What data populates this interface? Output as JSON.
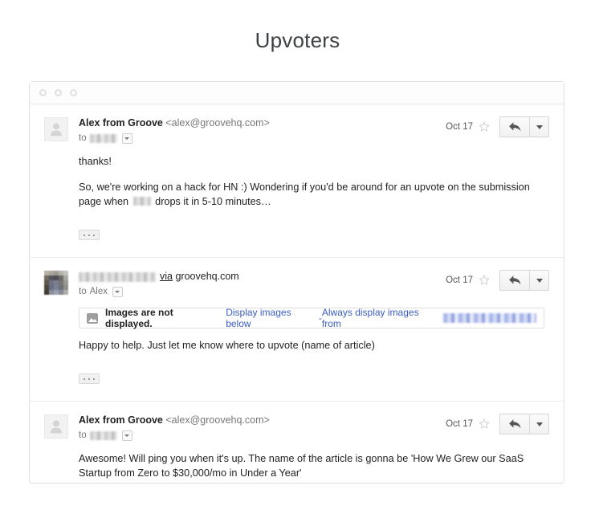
{
  "page": {
    "title": "Upvoters"
  },
  "window": {
    "traffic_lights": [
      "close-dot",
      "minimize-dot",
      "maximize-dot"
    ]
  },
  "thread": {
    "messages": [
      {
        "id": "message-1",
        "avatar_type": "default-person",
        "sender_name": "Alex from Groove",
        "sender_email": "<alex@groovehq.com>",
        "to_label": "to",
        "to_recipient_redacted": true,
        "date": "Oct 17",
        "star_state": "unstarred",
        "reply_label": "reply-arrow",
        "more_label": "more-options",
        "paragraphs": [
          "thanks!",
          "So, we're working on a hack for HN :) Wondering if you'd be around for an upvote on the submission page when ",
          " drops it in 5-10 minutes…"
        ],
        "has_redaction_inline": true,
        "has_trim_button": true,
        "has_image_bar": false
      },
      {
        "id": "message-2",
        "avatar_type": "blurred-photo",
        "sender_name_redacted": true,
        "via_word": "via",
        "via_domain": "groovehq.com",
        "to_label": "to",
        "to_recipient": "Alex",
        "date": "Oct 17",
        "star_state": "unstarred",
        "reply_label": "reply-arrow",
        "more_label": "more-options",
        "image_bar": {
          "warning": "Images are not displayed.",
          "display_below_link": "Display images below",
          "separator": " - ",
          "always_display_link": "Always display images from",
          "domain_redacted": true,
          "icon": "image-icon"
        },
        "paragraphs": [
          "Happy to help. Just let me know where to upvote (name of article)"
        ],
        "has_trim_button": true,
        "has_image_bar": true
      },
      {
        "id": "message-3",
        "avatar_type": "default-person",
        "sender_name": "Alex from Groove",
        "sender_email": "<alex@groovehq.com>",
        "to_label": "to",
        "to_recipient_redacted": true,
        "date": "Oct 17",
        "star_state": "unstarred",
        "reply_label": "reply-arrow",
        "more_label": "more-options",
        "paragraphs": [
          "Awesome! Will ping you when it's up. The name of the article is gonna be 'How We Grew our SaaS Startup from Zero to $30,000/mo in Under a Year'"
        ],
        "has_trim_button": false,
        "has_image_bar": false
      }
    ]
  },
  "colors": {
    "page_background": "#ffffff",
    "title_text": "#3c4043",
    "body_text": "#222222",
    "muted_text": "#777777",
    "link_blue": "#3b5ec4",
    "border": "#e2e2e2"
  }
}
